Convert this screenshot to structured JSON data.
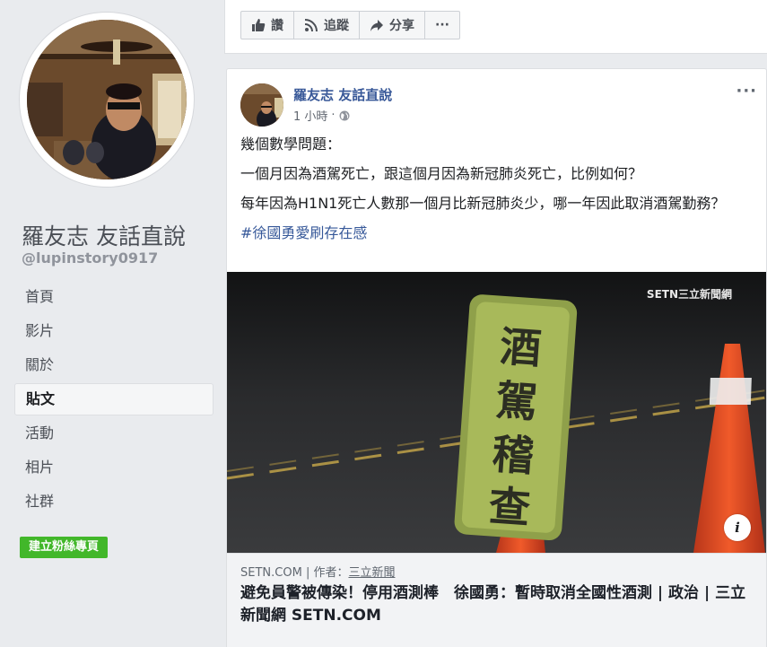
{
  "sidebar": {
    "page_name": "羅友志 友話直說",
    "handle": "@lupinstory0917",
    "nav": [
      {
        "label": "首頁"
      },
      {
        "label": "影片"
      },
      {
        "label": "關於"
      },
      {
        "label": "貼文",
        "active": true
      },
      {
        "label": "活動"
      },
      {
        "label": "相片"
      },
      {
        "label": "社群"
      }
    ],
    "create_button": "建立粉絲專頁"
  },
  "action_bar": {
    "like": "讚",
    "follow": "追蹤",
    "share": "分享",
    "more": "···"
  },
  "post": {
    "author": "羅友志 友話直說",
    "time": "1 小時",
    "separator": "·",
    "more": "···",
    "lines": [
      "幾個數學問題：",
      "一個月因為酒駕死亡，跟這個月因為新冠肺炎死亡，比例如何？",
      "每年因為H1N1死亡人數那一個月比新冠肺炎少，哪一年因此取消酒駕勤務？"
    ],
    "hashtag": "#徐國勇愛刷存在感",
    "image": {
      "sign_text": "酒駕稽查",
      "logo": "SETN三立新聞網",
      "info": "i"
    },
    "link": {
      "domain": "SETN.COM",
      "author_prefix": "| 作者：",
      "author": "三立新聞",
      "title": "避免員警被傳染！停用酒測棒　徐國勇：暫時取消全國性酒測 | 政治 | 三立新聞網 SETN.COM"
    }
  },
  "colors": {
    "link_blue": "#385898",
    "green_button": "#42b72a",
    "background": "#e9ebee"
  }
}
